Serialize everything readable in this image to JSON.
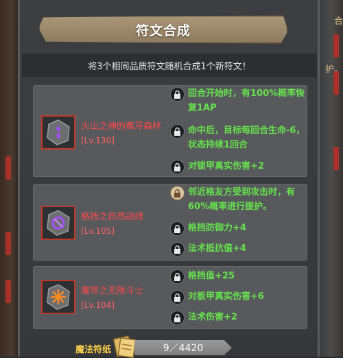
{
  "header": {
    "title": "符文合成",
    "subtitle": "将3个相同品质符文随机合成1个新符文！"
  },
  "side_fragments": {
    "right_top": "合",
    "right_mid": "护。"
  },
  "runes": [
    {
      "name": "火山之神的毒牙森林",
      "level": "[Lv.130]",
      "icon": "purple-arrows-rune-icon",
      "effects": [
        {
          "text": "回合开始时，有100%概率恢复1AP",
          "locked": true
        },
        {
          "text": "命中后，目标每回合生命-6，状态持续1回合",
          "locked": true
        },
        {
          "text": "对锁甲真实伤害+2",
          "locked": true
        }
      ]
    },
    {
      "name": "格挡之自然战线",
      "level": "[Lv.105]",
      "icon": "purple-swirl-rune-icon",
      "effects": [
        {
          "text": "邻近格友方受到攻击时，有60%概率进行援护。",
          "locked": false
        },
        {
          "text": "格挡防御力+4",
          "locked": true
        },
        {
          "text": "法术抵抗值+4",
          "locked": true
        }
      ]
    },
    {
      "name": "魔导之无限斗士",
      "level": "[Lv.104]",
      "icon": "orange-star-rune-icon",
      "effects": [
        {
          "text": "格挡值+25",
          "locked": true
        },
        {
          "text": "对板甲真实伤害+6",
          "locked": true
        },
        {
          "text": "法术伤害+2",
          "locked": true
        }
      ]
    }
  ],
  "currency": {
    "label": "魔法符纸",
    "count": "9／4420",
    "icon": "scroll-paper-icon"
  },
  "colors": {
    "rune_name": "#ff4a4a",
    "effect_text": "#66e14d",
    "currency_label": "#ffd24a",
    "icon_border": "#c0392b"
  }
}
